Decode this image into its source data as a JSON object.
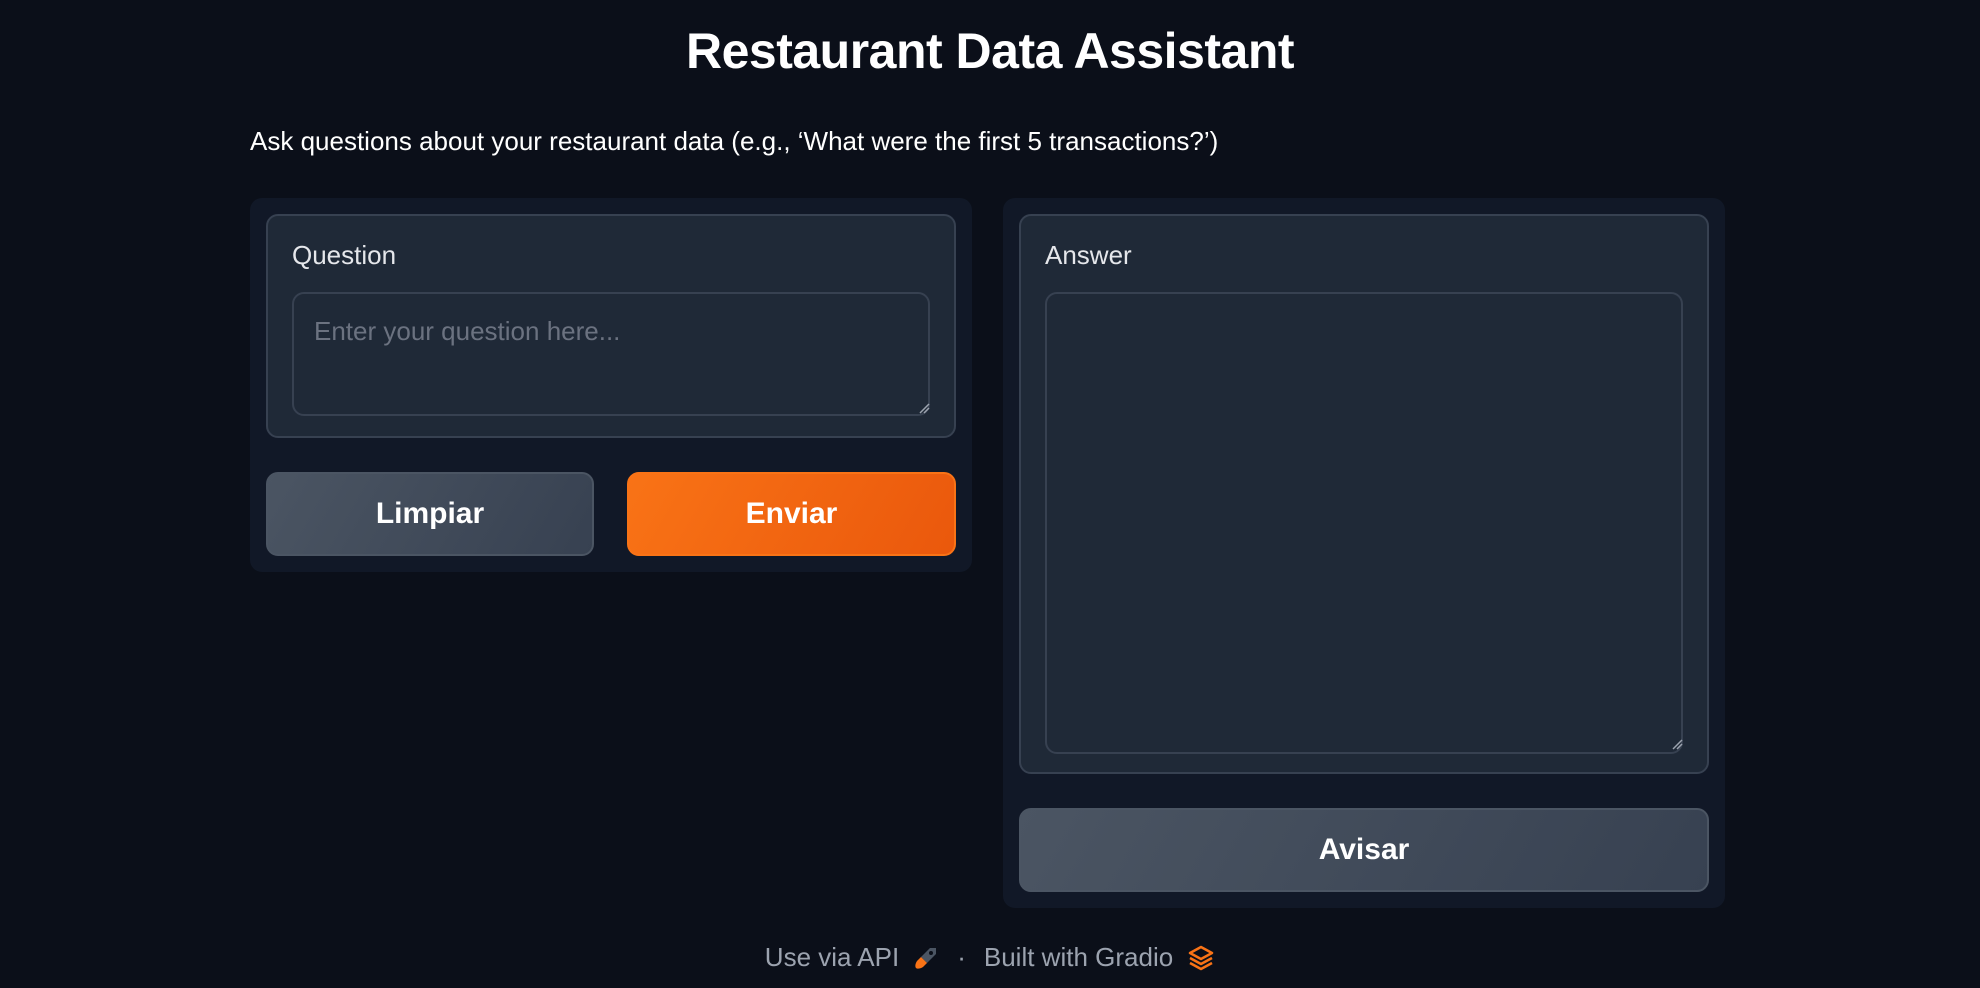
{
  "header": {
    "title": "Restaurant Data Assistant",
    "description": "Ask questions about your restaurant data (e.g., ‘What were the first 5 transactions?’)"
  },
  "question": {
    "label": "Question",
    "placeholder": "Enter your question here...",
    "value": ""
  },
  "buttons": {
    "clear_label": "Limpiar",
    "submit_label": "Enviar",
    "flag_label": "Avisar"
  },
  "answer": {
    "label": "Answer",
    "value": ""
  },
  "footer": {
    "api_label": "Use via API",
    "separator": "·",
    "built_label": "Built with Gradio",
    "api_icon": "rocket-icon",
    "gradio_icon": "gradio-logo-icon"
  },
  "colors": {
    "background": "#0b0f19",
    "panel": "#111827",
    "block": "#1f2937",
    "accent": "#f97316",
    "secondary_button": "#4b5563"
  }
}
